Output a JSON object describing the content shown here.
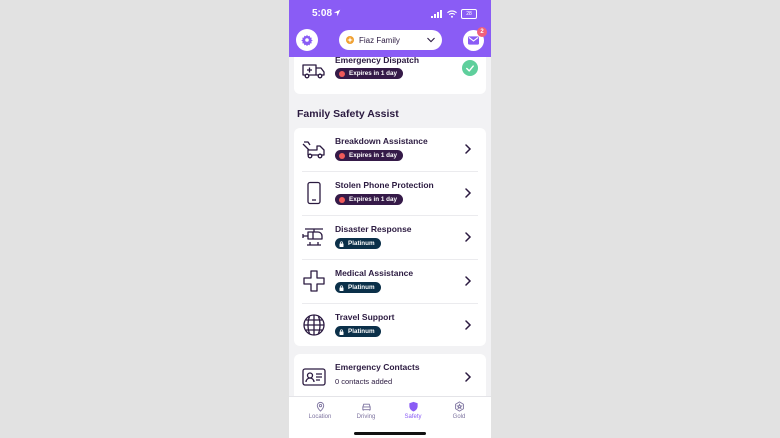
{
  "status_bar": {
    "time": "5:08",
    "battery": "28"
  },
  "header": {
    "family_name": "Fiaz Family",
    "mail_badge": "2"
  },
  "emergency_dispatch": {
    "title": "Emergency Dispatch",
    "badge": "Expires in 1 day"
  },
  "section": {
    "title": "Family Safety Assist"
  },
  "assist_items": [
    {
      "title": "Breakdown Assistance",
      "badge": "Expires in 1 day",
      "badge_type": "expires",
      "icon": "tow-truck-icon"
    },
    {
      "title": "Stolen Phone Protection",
      "badge": "Expires in 1 day",
      "badge_type": "expires",
      "icon": "phone-icon"
    },
    {
      "title": "Disaster Response",
      "badge": "Platinum",
      "badge_type": "platinum",
      "icon": "helicopter-icon"
    },
    {
      "title": "Medical Assistance",
      "badge": "Platinum",
      "badge_type": "platinum",
      "icon": "medical-cross-icon"
    },
    {
      "title": "Travel Support",
      "badge": "Platinum",
      "badge_type": "platinum",
      "icon": "globe-icon"
    }
  ],
  "contacts": {
    "title": "Emergency Contacts",
    "subtitle": "0 contacts added"
  },
  "tabs": [
    {
      "label": "Location",
      "icon": "location-pin-icon",
      "active": false
    },
    {
      "label": "Driving",
      "icon": "car-icon",
      "active": false
    },
    {
      "label": "Safety",
      "icon": "shield-icon",
      "active": true
    },
    {
      "label": "Gold",
      "icon": "gold-badge-icon",
      "active": false
    }
  ],
  "colors": {
    "accent": "#8a5cf5",
    "expires_pill": "#351a48",
    "platinum_pill": "#0b3049",
    "check": "#5fcf9c"
  }
}
